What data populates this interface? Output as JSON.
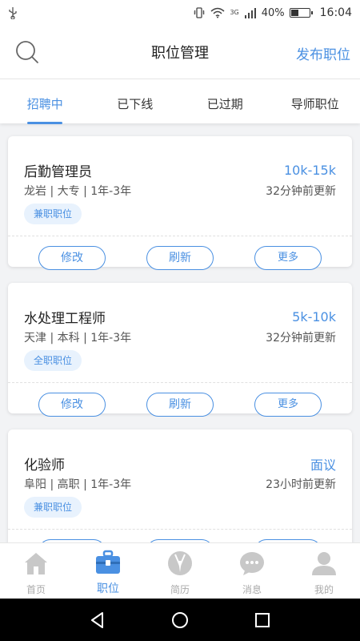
{
  "status_bar": {
    "left_icon": "usb-icon",
    "battery_percent": "40%",
    "battery_level": 0.4,
    "time": "16:04",
    "network": "3G"
  },
  "header": {
    "title": "职位管理",
    "publish_label": "发布职位",
    "search_icon": "search-icon"
  },
  "tabs": [
    {
      "label": "招聘中",
      "active": true
    },
    {
      "label": "已下线",
      "active": false
    },
    {
      "label": "已过期",
      "active": false
    },
    {
      "label": "导师职位",
      "active": false
    }
  ],
  "jobs": [
    {
      "title": "后勤管理员",
      "salary": "10k-15k",
      "info": "龙岩 | 大专 | 1年-3年",
      "updated": "32分钟前更新",
      "tag": "兼职职位"
    },
    {
      "title": "水处理工程师",
      "salary": "5k-10k",
      "info": "天津 | 本科 | 1年-3年",
      "updated": "32分钟前更新",
      "tag": "全职职位"
    },
    {
      "title": "化验师",
      "salary": "面议",
      "info": "阜阳 | 高职 | 1年-3年",
      "updated": "23小时前更新",
      "tag": "兼职职位"
    }
  ],
  "card_actions": {
    "edit": "修改",
    "refresh": "刷新",
    "more": "更多"
  },
  "bottom_nav": [
    {
      "label": "首页",
      "icon": "home-icon",
      "active": false
    },
    {
      "label": "职位",
      "icon": "briefcase-icon",
      "active": true
    },
    {
      "label": "简历",
      "icon": "resume-icon",
      "active": false
    },
    {
      "label": "消息",
      "icon": "message-icon",
      "active": false
    },
    {
      "label": "我的",
      "icon": "profile-icon",
      "active": false
    }
  ],
  "colors": {
    "accent": "#4a90e2",
    "tag_bg": "#e8f2fd",
    "inactive_icon": "#c8c8c8"
  }
}
